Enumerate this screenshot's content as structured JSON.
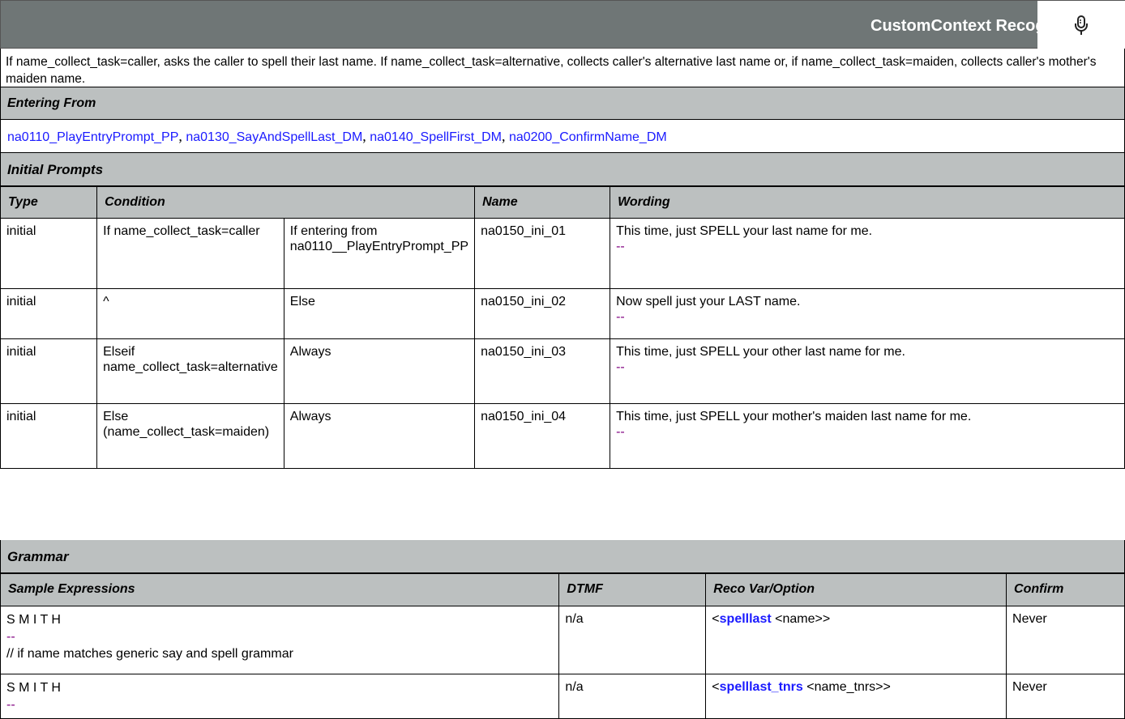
{
  "header": {
    "title": "CustomContext Recognition",
    "icon": "microphone-icon"
  },
  "description": "If name_collect_task=caller, asks the caller to spell their last name. If name_collect_task=alternative, collects caller's alternative last name or, if name_collect_task=maiden, collects caller's mother's maiden name.",
  "entering_from": {
    "label": "Entering From",
    "links": [
      "na0110_PlayEntryPrompt_PP",
      "na0130_SayAndSpellLast_DM",
      "na0140_SpellFirst_DM",
      "na0200_ConfirmName_DM"
    ],
    "separator": ","
  },
  "initial_prompts": {
    "label": "Initial Prompts",
    "columns": {
      "type": "Type",
      "condition": "Condition",
      "name": "Name",
      "wording": "Wording"
    },
    "rows": [
      {
        "type": "initial",
        "cond1": "If name_collect_task=caller",
        "cond2": "If entering from na0110__PlayEntryPrompt_PP",
        "name": "na0150_ini_01",
        "wording": "This time, just SPELL your last name for me.",
        "dash": "--"
      },
      {
        "type": "initial",
        "cond1": "^",
        "cond2": "Else",
        "name": "na0150_ini_02",
        "wording": "Now spell just your LAST name.",
        "dash": "--"
      },
      {
        "type": "initial",
        "cond1": "Elseif name_collect_task=alternative",
        "cond2": "Always",
        "name": "na0150_ini_03",
        "wording": "This time, just SPELL your other last name for me.",
        "dash": "--"
      },
      {
        "type": "initial",
        "cond1": "Else (name_collect_task=maiden)",
        "cond2": "Always",
        "name": "na0150_ini_04",
        "wording": "This time, just SPELL your mother's maiden last name for me.",
        "dash": "--"
      }
    ]
  },
  "grammar": {
    "label": "Grammar",
    "columns": {
      "samples": "Sample Expressions",
      "dtmf": "DTMF",
      "reco": "Reco Var/Option",
      "confirm": "Confirm"
    },
    "rows": [
      {
        "sample": "S M I T H",
        "dash": "--",
        "comment": "// if name matches generic say and spell grammar",
        "dtmf": "n/a",
        "reco_open": "<",
        "reco_var": "spelllast",
        "reco_rest": " <name>>",
        "confirm": "Never"
      },
      {
        "sample": "S M I T H",
        "dash": "--",
        "comment": "",
        "dtmf": "n/a",
        "reco_open": "<",
        "reco_var": "spelllast_tnrs",
        "reco_rest": " <name_tnrs>>",
        "confirm": "Never"
      }
    ]
  }
}
